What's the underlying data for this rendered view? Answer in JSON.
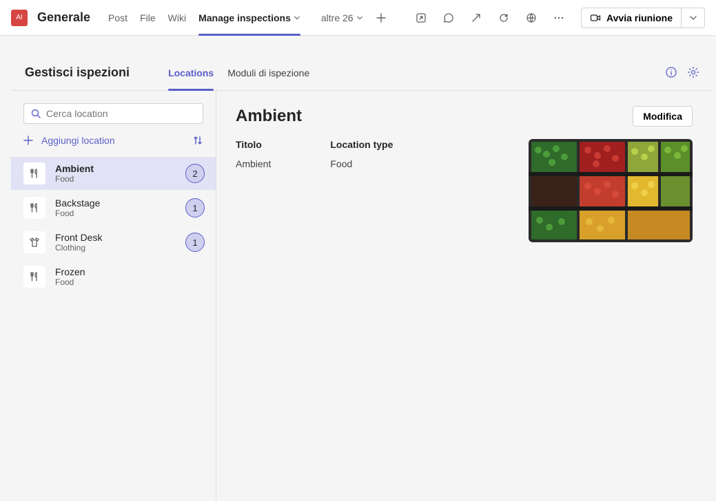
{
  "header": {
    "avatar_initials": "AI",
    "channel_title": "Generale",
    "tabs": {
      "post": "Post",
      "file": "File",
      "wiki": "Wiki",
      "manage": "Manage inspections",
      "more": "altre 26"
    },
    "meet_label": "Avvia riunione"
  },
  "app": {
    "title": "Gestisci ispezioni",
    "tabs": {
      "locations": "Locations",
      "forms": "Moduli di ispezione"
    }
  },
  "sidebar": {
    "search_placeholder": "Cerca location",
    "add_label": "Aggiungi location",
    "items": [
      {
        "name": "Ambient",
        "sub": "Food",
        "icon": "food",
        "badge": "2",
        "selected": true
      },
      {
        "name": "Backstage",
        "sub": "Food",
        "icon": "food",
        "badge": "1",
        "selected": false
      },
      {
        "name": "Front Desk",
        "sub": "Clothing",
        "icon": "clothing",
        "badge": "1",
        "selected": false
      },
      {
        "name": "Frozen",
        "sub": "Food",
        "icon": "food",
        "badge": null,
        "selected": false
      }
    ]
  },
  "detail": {
    "title": "Ambient",
    "edit_label": "Modifica",
    "title_label": "Titolo",
    "title_value": "Ambient",
    "type_label": "Location type",
    "type_value": "Food"
  },
  "colors": {
    "accent": "#5b5fc7",
    "badge_bg": "#cfd0f0",
    "selected_bg": "#e1e2f5"
  }
}
